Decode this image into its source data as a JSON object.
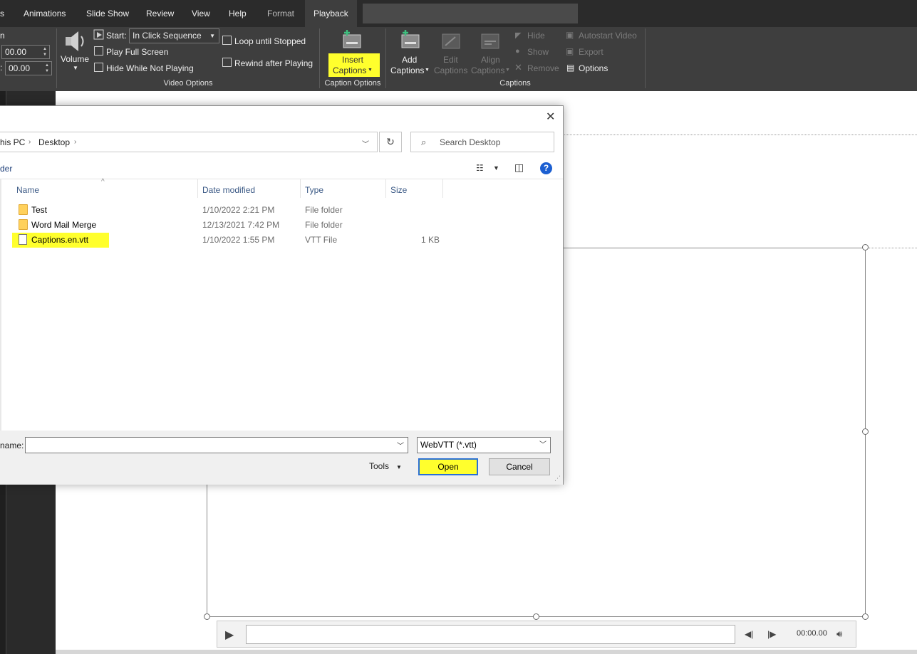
{
  "ribbon": {
    "tabs": [
      "s",
      "Animations",
      "Slide Show",
      "Review",
      "View",
      "Help",
      "Format",
      "Playback"
    ],
    "active_tab": "Playback",
    "fade_in_label": "n",
    "fade_in_value": "00.00",
    "fade_out_label": ":",
    "fade_out_value": "00.00",
    "volume_label": "Volume",
    "start_label": "Start:",
    "start_value": "In Click Sequence",
    "play_full_screen": "Play Full Screen",
    "hide_while_not_playing": "Hide While Not Playing",
    "loop_until_stopped": "Loop until Stopped",
    "rewind_after_playing": "Rewind after Playing",
    "video_options_group": "Video Options",
    "insert_captions_line1": "Insert",
    "insert_captions_line2": "Captions",
    "caption_options_group": "Caption Options",
    "add_captions_line1": "Add",
    "add_captions_line2": "Captions",
    "edit_captions_line1": "Edit",
    "edit_captions_line2": "Captions",
    "align_captions_line1": "Align",
    "align_captions_line2": "Captions",
    "hide": "Hide",
    "show": "Show",
    "remove": "Remove",
    "autostart_video": "Autostart Video",
    "export": "Export",
    "options": "Options",
    "captions_group": "Captions"
  },
  "dialog": {
    "breadcrumb": [
      "his PC",
      "Desktop"
    ],
    "search_placeholder": "Search Desktop",
    "new_folder": "der",
    "columns": {
      "name": "Name",
      "date": "Date modified",
      "type": "Type",
      "size": "Size"
    },
    "files": [
      {
        "name": "Test",
        "date": "1/10/2022 2:21 PM",
        "type": "File folder",
        "size": ""
      },
      {
        "name": "Word Mail Merge",
        "date": "12/13/2021 7:42 PM",
        "type": "File folder",
        "size": ""
      },
      {
        "name": "Captions.en.vtt",
        "date": "1/10/2022 1:55 PM",
        "type": "VTT File",
        "size": "1 KB"
      }
    ],
    "file_name_label": "name:",
    "file_name_value": "",
    "file_type": "WebVTT (*.vtt)",
    "tools": "Tools",
    "open": "Open",
    "cancel": "Cancel"
  },
  "player": {
    "time": "00:00.00"
  },
  "colors": {
    "highlight": "#ffff2d",
    "ribbon": "#3e3e3e",
    "tabbar": "#2b2b2b"
  }
}
